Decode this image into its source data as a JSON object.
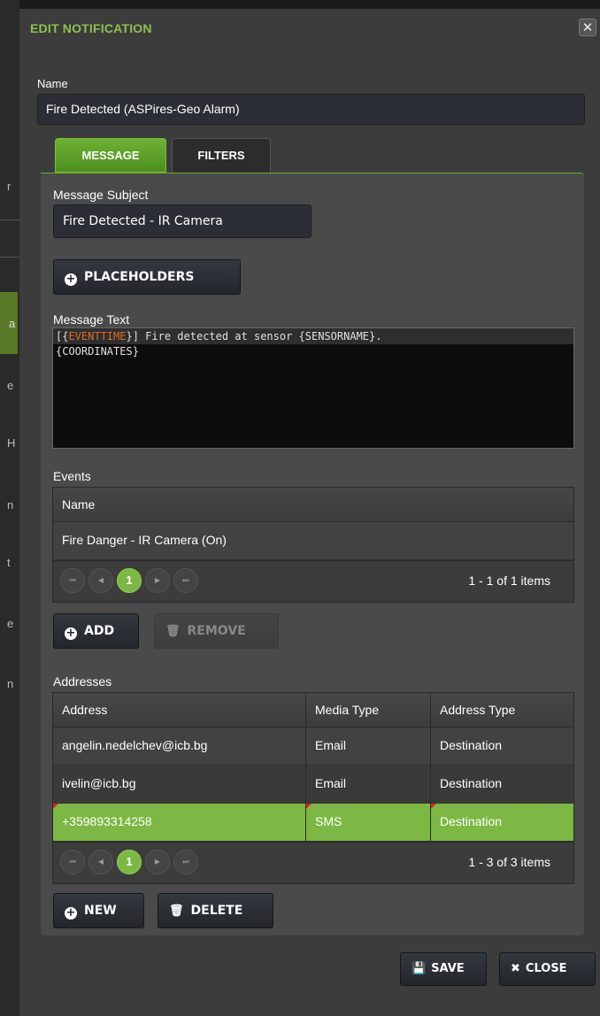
{
  "window": {
    "title": "EDIT NOTIFICATION",
    "close_x": "✕"
  },
  "name_field": {
    "label": "Name",
    "value": "Fire Detected (ASPires-Geo Alarm)"
  },
  "tabs": [
    {
      "label": "MESSAGE",
      "active": true
    },
    {
      "label": "FILTERS",
      "active": false
    }
  ],
  "message": {
    "subject_label": "Message Subject",
    "subject_value": "Fire Detected - IR Camera",
    "placeholders_button": "PLACEHOLDERS",
    "text_label": "Message Text",
    "text_line1_prefix": "[{",
    "text_line1_placeholder": "EVENTTIME",
    "text_line1_suffix": "}] Fire detected at sensor {SENSORNAME}.",
    "text_line2": "{COORDINATES}"
  },
  "events": {
    "label": "Events",
    "columns": [
      "Name"
    ],
    "rows": [
      [
        "Fire Danger - IR Camera (On)"
      ]
    ],
    "pager": {
      "first": "⏮",
      "prev": "◀",
      "page": "1",
      "next": "▶",
      "last": "⏭",
      "info": "1 - 1 of 1 items"
    },
    "add_button": "ADD",
    "remove_button": "REMOVE"
  },
  "addresses": {
    "label": "Addresses",
    "columns": [
      "Address",
      "Media Type",
      "Address Type"
    ],
    "rows": [
      [
        "angelin.nedelchev@icb.bg",
        "Email",
        "Destination"
      ],
      [
        "ivelin@icb.bg",
        "Email",
        "Destination"
      ],
      [
        "+359893314258",
        "SMS",
        "Destination"
      ]
    ],
    "pager": {
      "first": "⏮",
      "prev": "◀",
      "page": "1",
      "next": "▶",
      "last": "⏭",
      "info": "1 - 3 of 3 items"
    },
    "new_button": "NEW",
    "delete_button": "DELETE"
  },
  "footer": {
    "save_button": "SAVE",
    "close_button": "CLOSE"
  },
  "background_fragments": [
    "r",
    "a",
    "e",
    "H",
    "n",
    "t",
    "e",
    "n"
  ],
  "colors": {
    "accent": "#8bc34a",
    "selected_row": "#7cb843",
    "placeholder_token": "#e06a2a"
  }
}
